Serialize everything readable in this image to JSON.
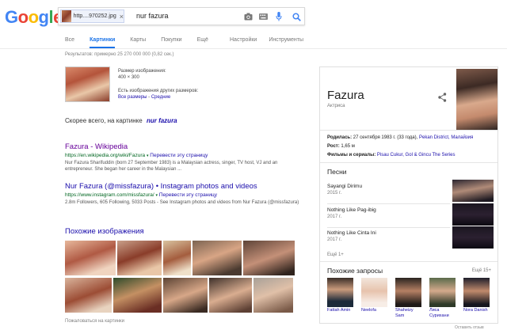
{
  "logo": {
    "text": "Google",
    "letters": [
      "G",
      "o",
      "o",
      "g",
      "l",
      "e"
    ],
    "colors": [
      "#4285f4",
      "#ea4335",
      "#fbbc05",
      "#4285f4",
      "#34a853",
      "#ea4335"
    ]
  },
  "search": {
    "chip_label": "http....970252.jpg",
    "chip_close": "×",
    "query": "nur fazura",
    "icons": [
      "camera-icon",
      "keyboard-icon",
      "mic-icon",
      "search-icon"
    ],
    "accent": "#4285f4"
  },
  "tabs": {
    "left": [
      "Все",
      "Картинки",
      "Карты",
      "Покупки",
      "Ещё"
    ],
    "active": "Картинки",
    "right": [
      "Настройки",
      "Инструменты"
    ]
  },
  "results_stats": "Результатов: примерно 25 270 000 000 (0,82 сек.)",
  "image_info": {
    "size_label": "Размер изображения:",
    "size_value": "400 × 300",
    "other_sizes": "Есть изображения других размеров:",
    "links_all": "Все размеры",
    "links_sep": " - ",
    "links_medium": "Средние"
  },
  "best_guess": {
    "label": "Скорее всего, на картинке",
    "value": "nur fazura"
  },
  "results": [
    {
      "title": "Fazura - Wikipedia",
      "url": "https://en.wikipedia.org/wiki/Fazura",
      "translate": "Перевести эту страницу",
      "snippet": "Nur Fazura Sharifuddin (born 27 September 1983) is a Malaysian actress, singer, TV host, VJ and an entrepreneur. She began her career in the Malaysian ..."
    },
    {
      "title": "Nur Fazura (@missfazura) • Instagram photos and videos",
      "url": "https://www.instagram.com/missfazura/",
      "translate": "Перевести эту страницу",
      "snippet": "2.8m Followers, 605 Following, 5033 Posts - See Instagram photos and videos from Nur Fazura (@missfazura)"
    }
  ],
  "similar": {
    "title": "Похожие изображения",
    "report": "Пожаловаться на картинки"
  },
  "knowledge_panel": {
    "name": "Fazura",
    "subtitle": "Актриса",
    "born_label": "Родилась:",
    "born_value": "27 сентября 1983 г. (33 года),",
    "born_place": "Pekan District, Малайзия",
    "height_label": "Рост:",
    "height_value": "1,65 м",
    "films_label": "Фильмы и сериалы:",
    "films_value": "Pisau Cukur, Gol & Gincu The Series",
    "songs_heading": "Песни",
    "songs": [
      {
        "title": "Sayangi Dirimu",
        "year": "2015 г."
      },
      {
        "title": "Nothing Like Pag-ibig",
        "year": "2017 г."
      },
      {
        "title": "Nothing Like Cinta Ini",
        "year": "2017 г."
      }
    ],
    "songs_more": "Ещё 1+",
    "related_heading": "Похожие запросы",
    "related_more": "Ещё 15+",
    "related": [
      {
        "name": "Fattah Amin"
      },
      {
        "name": "Neelofa"
      },
      {
        "name": "Shaheizy Sam"
      },
      {
        "name": "Лиса Сурихани"
      },
      {
        "name": "Nora Danish"
      }
    ]
  },
  "feedback": "Оставить отзыв"
}
